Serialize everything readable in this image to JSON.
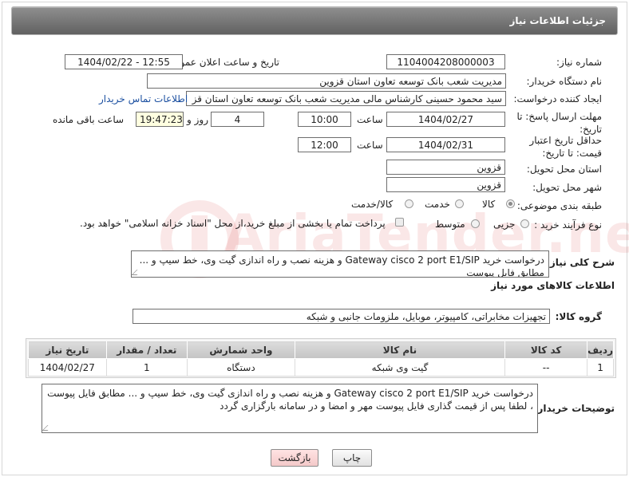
{
  "header": {
    "title": "جزئیات اطلاعات نیاز"
  },
  "need_number": {
    "label": "شماره نیاز:",
    "value": "1104004208000003"
  },
  "announce_datetime": {
    "label": "تاریخ و ساعت اعلان عمومی:",
    "value": "1404/02/22 - 12:55"
  },
  "buyer_org": {
    "label": "نام دستگاه خریدار:",
    "value": "مدیریت شعب بانک توسعه تعاون استان قزوین"
  },
  "requester": {
    "label": "ایجاد کننده درخواست:",
    "value": "سید محمود حسینی کارشناس مالی مدیریت شعب بانک توسعه تعاون استان قز",
    "contact_link": "اطلاعات تماس خریدار"
  },
  "reply_deadline": {
    "label": "مهلت ارسال پاسخ: تا تاریخ:",
    "date": "1404/02/27",
    "time_label": "ساعت",
    "time": "10:00",
    "days": "4",
    "days_label": "روز و",
    "remaining": "19:47:23",
    "remaining_label": "ساعت باقی مانده"
  },
  "price_validity": {
    "label": "حداقل تاریخ اعتبار قیمت: تا تاریخ:",
    "date": "1404/02/31",
    "time_label": "ساعت",
    "time": "12:00"
  },
  "delivery_province": {
    "label": "استان محل تحویل:",
    "value": "قزوین"
  },
  "delivery_city": {
    "label": "شهر محل تحویل:",
    "value": "قزوین"
  },
  "category": {
    "label": "طبقه بندی موضوعی:",
    "options": [
      "کالا",
      "خدمت",
      "کالا/خدمت"
    ],
    "selected": "کالا"
  },
  "process_type": {
    "label": "نوع فرآیند خرید :",
    "options": [
      "جزیی",
      "متوسط"
    ],
    "payment_note": "پرداخت تمام یا بخشی از مبلغ خرید،از محل \"اسناد خزانه اسلامی\" خواهد بود."
  },
  "general_description": {
    "label": "شرح کلی نیاز:",
    "value": "درخواست خرید Gateway cisco 2 port E1/SIP و هزینه نصب و راه اندازی گیت وی، خط سیپ و ... مطابق فایل پیوست"
  },
  "goods_info": {
    "title": "اطلاعات کالاهای مورد نیاز"
  },
  "goods_group": {
    "label": "گروه کالا:",
    "value": "تجهیزات مخابراتی، کامپیوتر، موبایل، ملزومات جانبی و شبکه"
  },
  "items_table": {
    "headers": [
      "ردیف",
      "کد کالا",
      "نام کالا",
      "واحد شمارش",
      "تعداد / مقدار",
      "تاریخ نیاز"
    ],
    "rows": [
      [
        "1",
        "--",
        "گیت وی شبکه",
        "دستگاه",
        "1",
        "1404/02/27"
      ]
    ]
  },
  "buyer_notes": {
    "label": "توضیحات خریدار:",
    "value": "درخواست خرید Gateway cisco 2 port E1/SIP و هزینه نصب و راه اندازی گیت وی، خط سیپ و ... مطابق فایل پیوست ، لطفا پس از قیمت گذاری فایل پیوست مهر و امضا و در سامانه بارگزاری گردد"
  },
  "buttons": {
    "print": "چاپ",
    "back": "بازگشت"
  },
  "watermark": {
    "text": "AriaTender.neT"
  },
  "colors": {
    "header_bg": "#6f6f6f",
    "link": "#1b4fa0",
    "back_button": "#f4c9c9"
  }
}
